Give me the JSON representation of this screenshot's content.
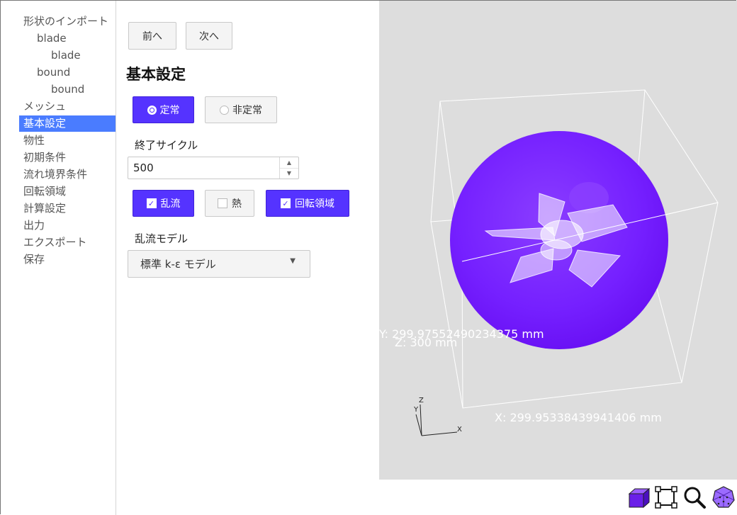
{
  "sidebar": {
    "items": [
      {
        "label": "形状のインポート",
        "level": 0,
        "active": false
      },
      {
        "label": "blade",
        "level": 1,
        "active": false
      },
      {
        "label": "blade",
        "level": 2,
        "active": false
      },
      {
        "label": "bound",
        "level": 1,
        "active": false
      },
      {
        "label": "bound",
        "level": 2,
        "active": false
      },
      {
        "label": "メッシュ",
        "level": 0,
        "active": false
      },
      {
        "label": "基本設定",
        "level": 0,
        "active": true
      },
      {
        "label": "物性",
        "level": 0,
        "active": false
      },
      {
        "label": "初期条件",
        "level": 0,
        "active": false
      },
      {
        "label": "流れ境界条件",
        "level": 0,
        "active": false
      },
      {
        "label": "回転領域",
        "level": 0,
        "active": false
      },
      {
        "label": "計算設定",
        "level": 0,
        "active": false
      },
      {
        "label": "出力",
        "level": 0,
        "active": false
      },
      {
        "label": "エクスポート",
        "level": 0,
        "active": false
      },
      {
        "label": "保存",
        "level": 0,
        "active": false
      }
    ],
    "active_color": "#4a7cff"
  },
  "nav": {
    "prev_label": "前へ",
    "next_label": "次へ"
  },
  "panel": {
    "title": "基本設定",
    "time_mode": {
      "steady_label": "定常",
      "unsteady_label": "非定常",
      "selected": "steady"
    },
    "end_cycle": {
      "label": "終了サイクル",
      "value": "500"
    },
    "options": {
      "turbulence": {
        "label": "乱流",
        "checked": true
      },
      "heat": {
        "label": "熱",
        "checked": false
      },
      "rotating_region": {
        "label": "回転領域",
        "checked": true
      }
    },
    "turbulence_model": {
      "label": "乱流モデル",
      "selected": "標準 k-ε モデル"
    },
    "accent_color": "#5533ff"
  },
  "viewport": {
    "background": "#dddddd",
    "dim_y": "Y: 299.97552490234375 mm",
    "dim_z": "Z: 300 mm",
    "dim_x": "X: 299.95338439941406 mm",
    "axes": {
      "x": "X",
      "y": "Y",
      "z": "Z"
    },
    "sphere_color": "#7a1fff"
  },
  "toolbar": {
    "tools": [
      {
        "name": "solid-view-icon"
      },
      {
        "name": "bounding-box-icon"
      },
      {
        "name": "zoom-icon"
      },
      {
        "name": "mesh-view-icon"
      }
    ]
  }
}
